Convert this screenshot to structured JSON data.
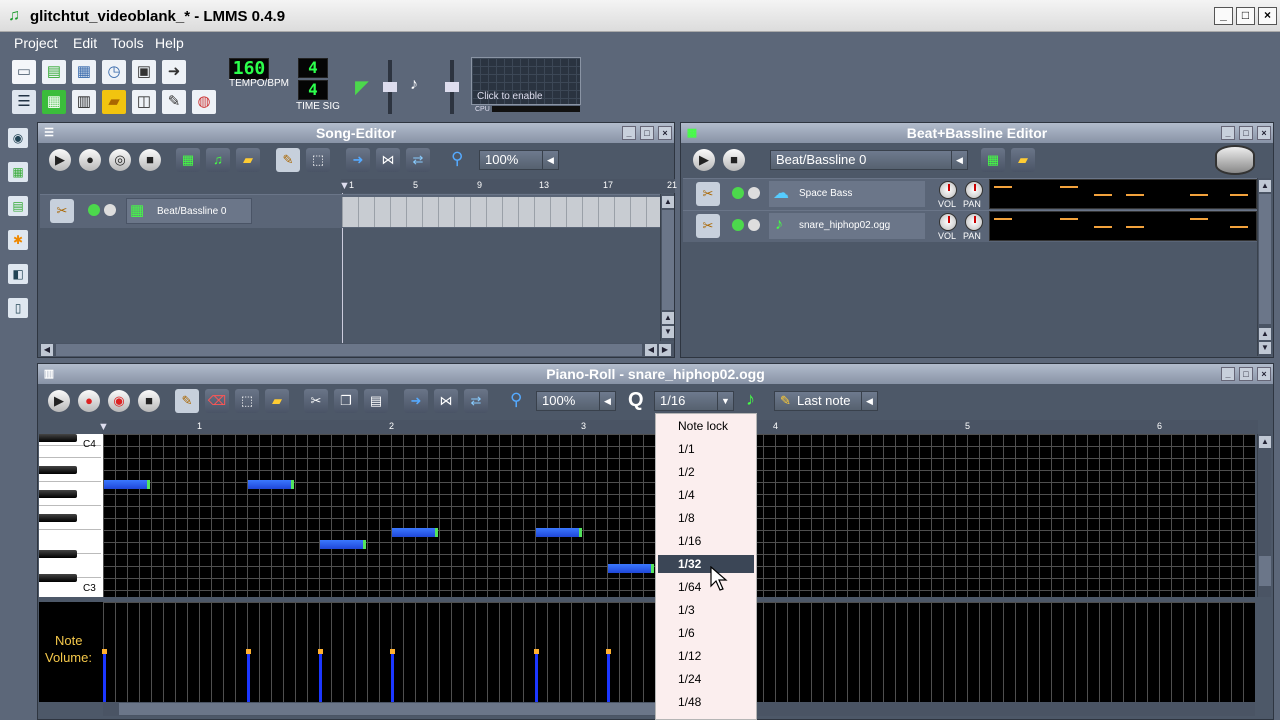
{
  "app": {
    "title": "glitchtut_videoblank_* - LMMS 0.4.9",
    "min": "_",
    "max": "□",
    "close": "×"
  },
  "menu": [
    "Project",
    "Edit",
    "Tools",
    "Help"
  ],
  "toolbar": {
    "tempo": "160",
    "tempo_label": "TEMPO/BPM",
    "timesig_num": "4",
    "timesig_den": "4",
    "timesig_label": "TIME SIG",
    "cpu_hint": "Click to enable",
    "cpu_label": "CPU"
  },
  "song_editor": {
    "title": "Song-Editor",
    "zoom": "100%",
    "ruler": [
      "1",
      "5",
      "9",
      "13",
      "17",
      "21"
    ],
    "track_name": "Beat/Bassline 0"
  },
  "bb_editor": {
    "title": "Beat+Bassline Editor",
    "selected": "Beat/Bassline 0",
    "tracks": [
      {
        "name": "Space Bass",
        "vol": "VOL",
        "pan": "PAN"
      },
      {
        "name": "snare_hiphop02.ogg",
        "vol": "VOL",
        "pan": "PAN"
      }
    ]
  },
  "piano_roll": {
    "title": "Piano-Roll - snare_hiphop02.ogg",
    "zoom": "100%",
    "q_label": "Q",
    "quantize": "1/16",
    "note_len": "Last note",
    "ruler": [
      "1",
      "2",
      "3",
      "4",
      "5",
      "6"
    ],
    "key_top": "C4",
    "key_bottom": "C3",
    "volume_label_1": "Note",
    "volume_label_2": "Volume:"
  },
  "quantize_menu": {
    "items": [
      "Note lock",
      "1/1",
      "1/2",
      "1/4",
      "1/8",
      "1/16",
      "1/32",
      "1/64",
      "1/3",
      "1/6",
      "1/12",
      "1/24",
      "1/48"
    ],
    "selected": "1/32"
  },
  "colors": {
    "bg": "#5c6779",
    "note": "#1f47d8",
    "lcd": "#2cff4c",
    "velocity_tip": "#ffb030"
  }
}
